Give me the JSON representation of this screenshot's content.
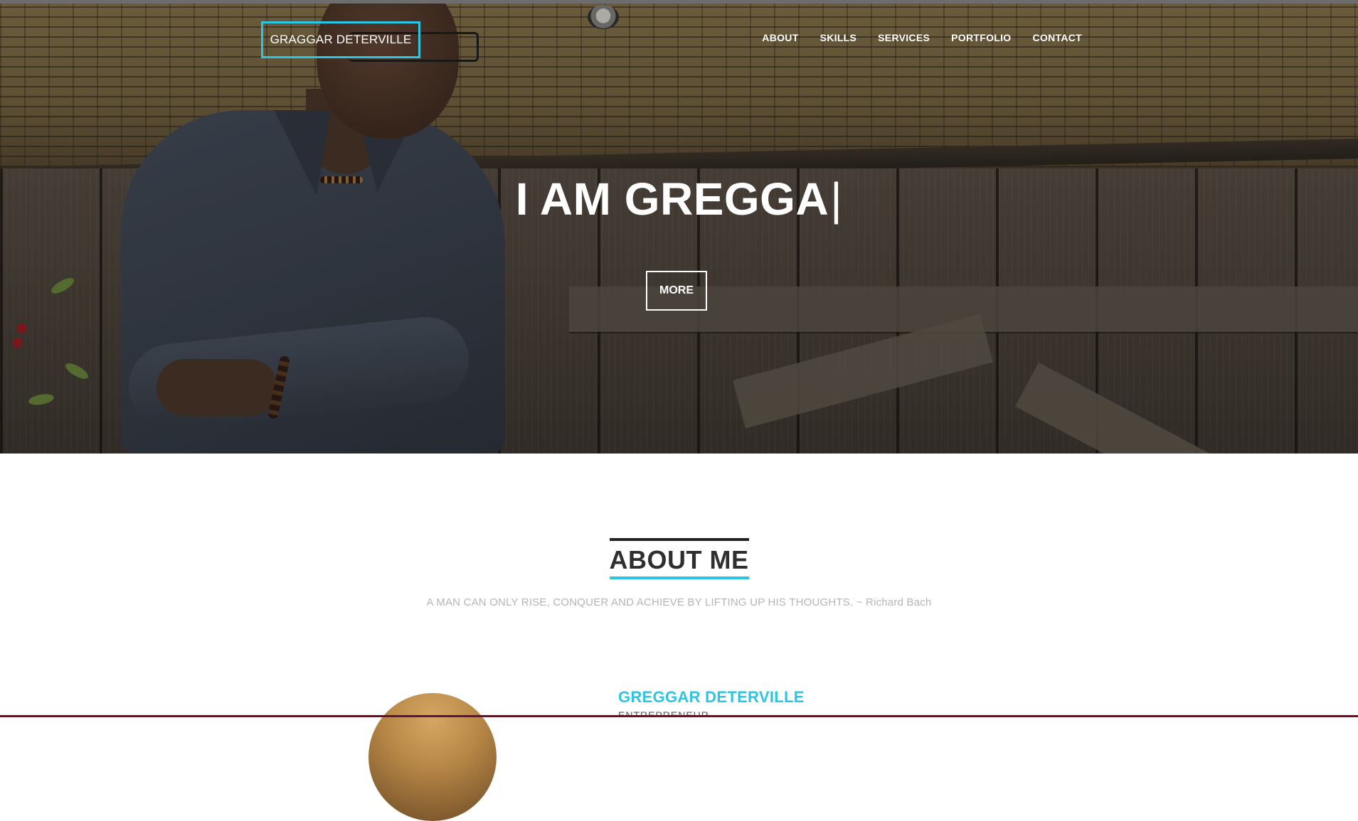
{
  "header": {
    "brand": "GRAGGAR DETERVILLE",
    "nav": [
      "ABOUT",
      "SKILLS",
      "SERVICES",
      "PORTFOLIO",
      "CONTACT"
    ]
  },
  "hero": {
    "title": "I AM GREGGA",
    "caret": "|",
    "button": "MORE"
  },
  "about": {
    "title": "ABOUT ME",
    "quote": "A MAN CAN ONLY RISE, CONQUER AND ACHIEVE BY LIFTING UP HIS THOUGHTS. ~ Richard Bach",
    "name": "GREGGAR DETERVILLE",
    "subtitle": "ENTREPRENEUR"
  },
  "colors": {
    "accent": "#2bc6e6",
    "heading": "#2f2f2f",
    "muted": "#b5b5b5"
  }
}
